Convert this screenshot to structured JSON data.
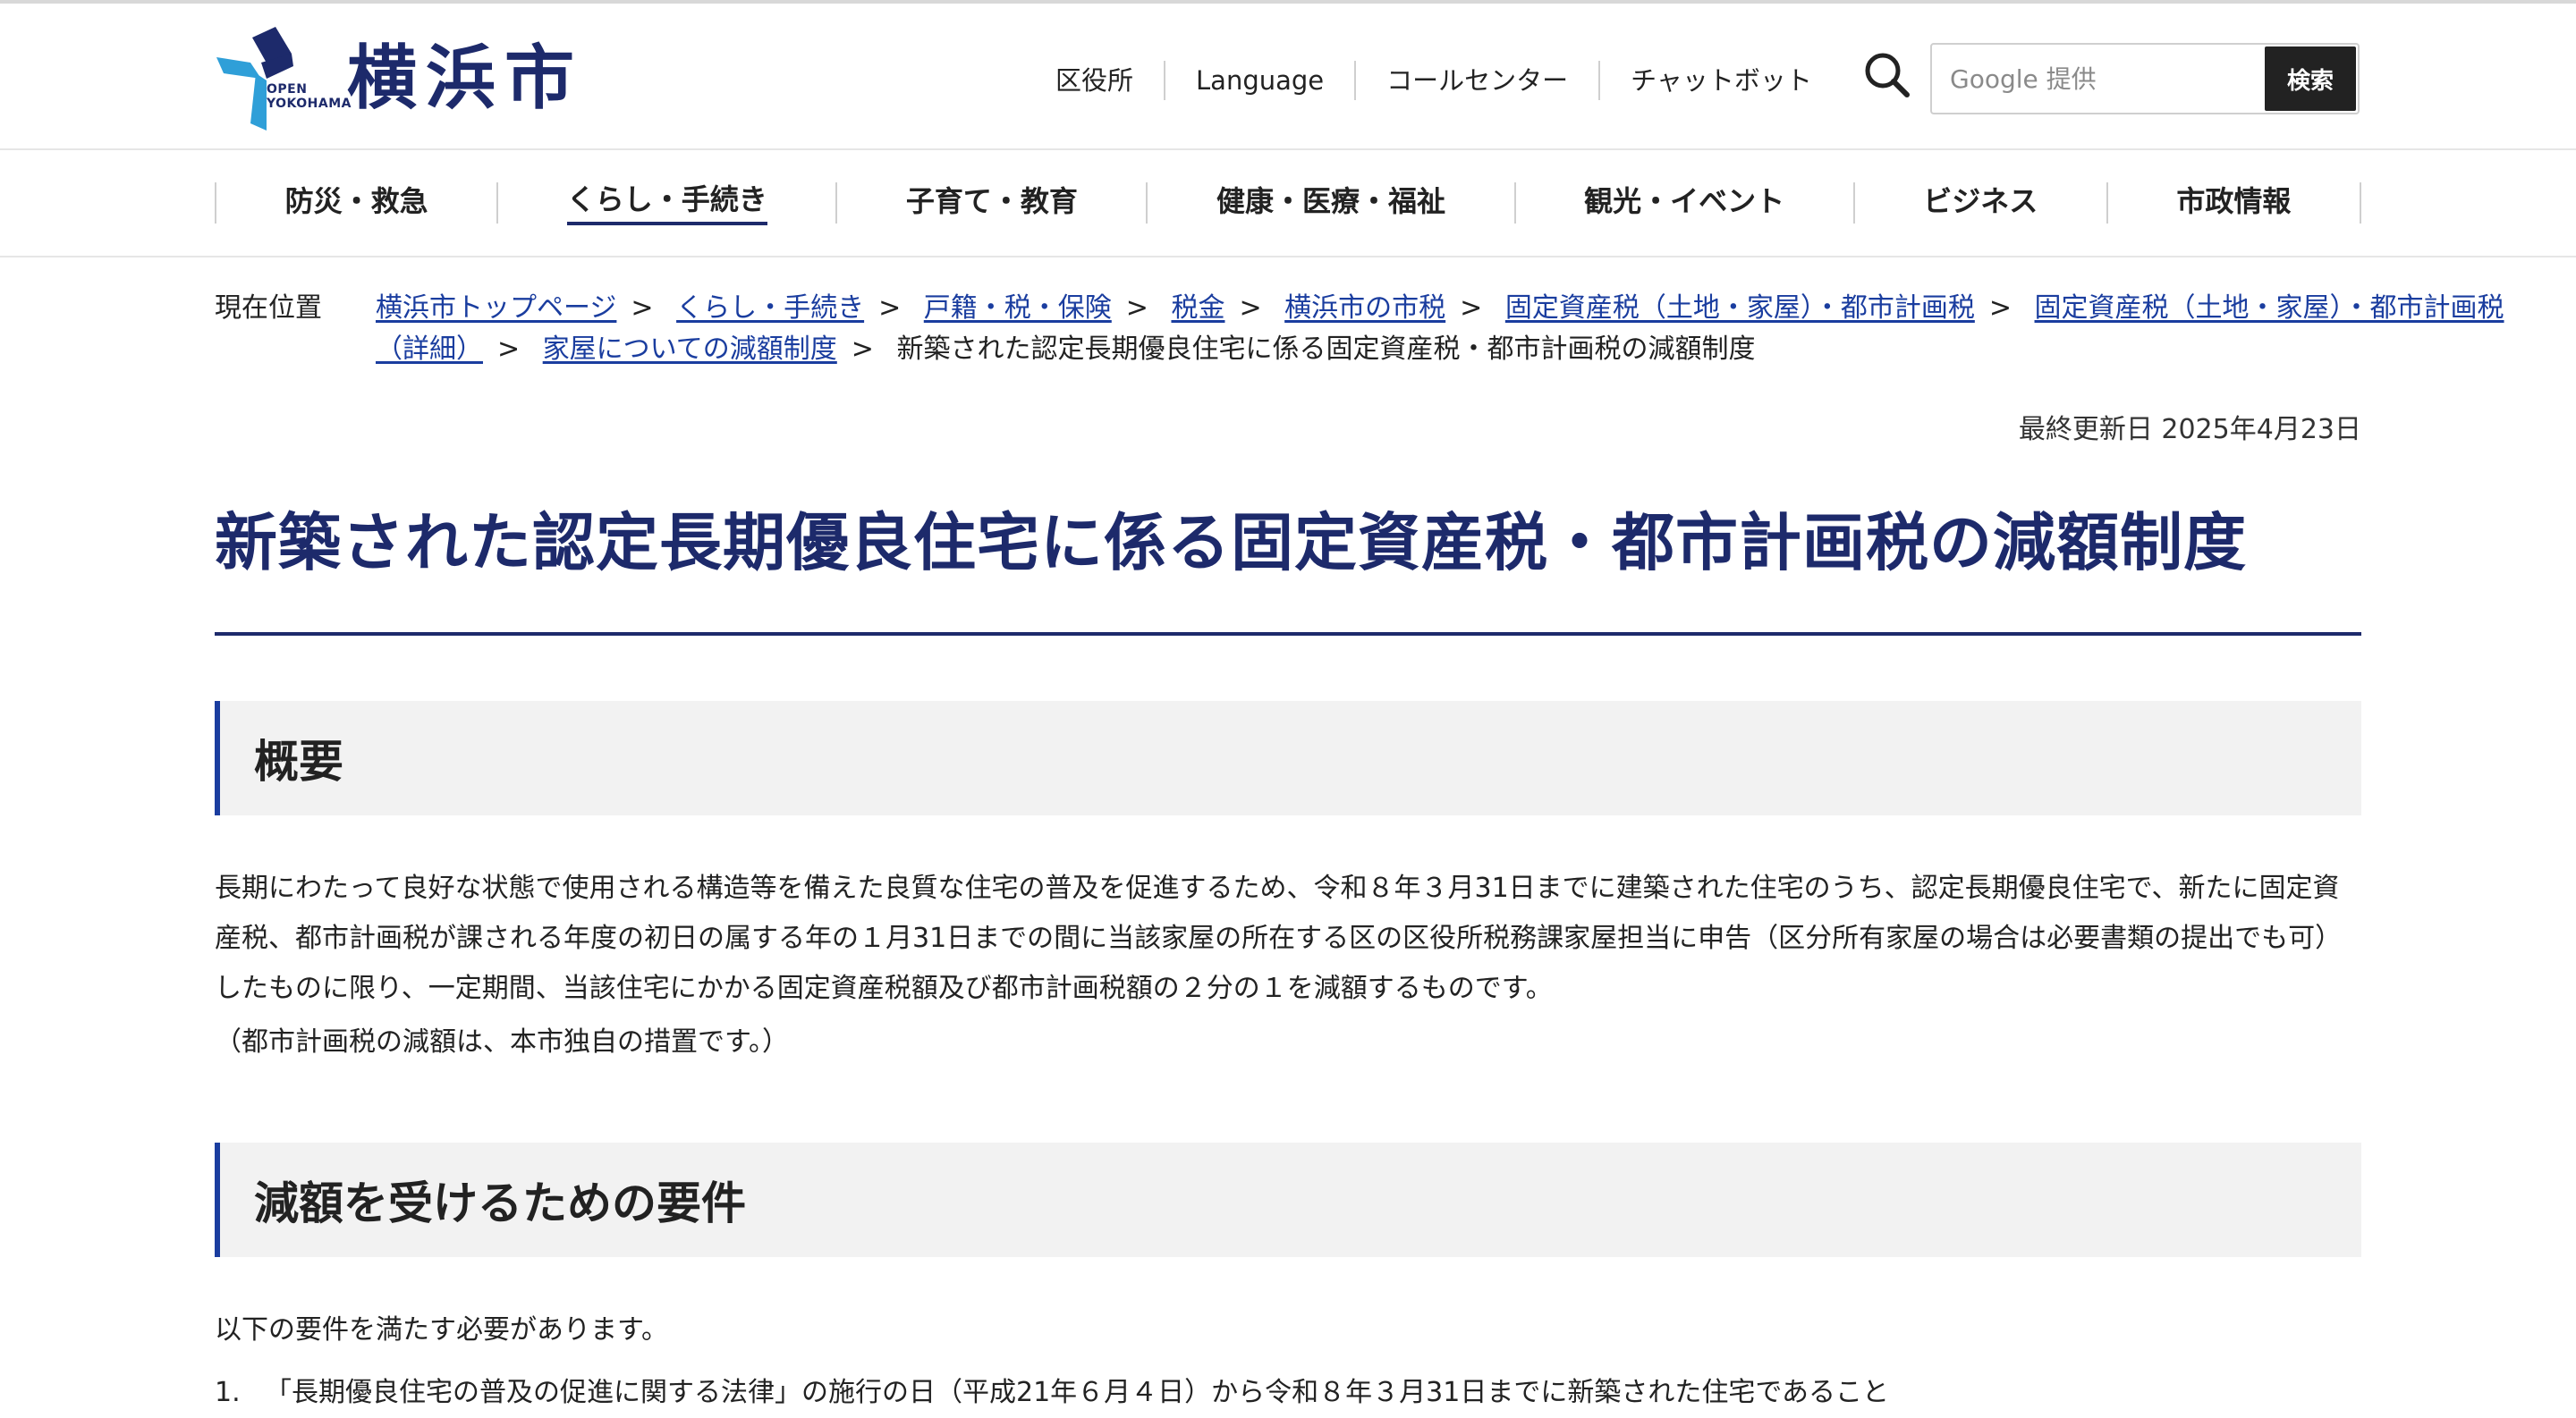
{
  "header": {
    "logo_text": "横浜市",
    "logo_sub_line1": "OPEN",
    "logo_sub_line2": "YOKOHAMA",
    "util_nav": [
      "区役所",
      "Language",
      "コールセンター",
      "チャットボット"
    ],
    "search": {
      "placeholder": "Google 提供",
      "button_label": "検索"
    }
  },
  "global_nav": [
    {
      "label": "防災・救急"
    },
    {
      "label": "くらし・手続き"
    },
    {
      "label": "子育て・教育"
    },
    {
      "label": "健康・医療・福祉"
    },
    {
      "label": "観光・イベント"
    },
    {
      "label": "ビジネス"
    },
    {
      "label": "市政情報"
    }
  ],
  "breadcrumb": {
    "label": "現在位置",
    "links": [
      "横浜市トップページ",
      "くらし・手続き",
      "戸籍・税・保険",
      "税金",
      "横浜市の市税",
      "固定資産税（土地・家屋）・都市計画税",
      "固定資産税（土地・家屋）・都市計画税（詳細）",
      "家屋についての減額制度"
    ],
    "current": "新築された認定長期優良住宅に係る固定資産税・都市計画税の減額制度"
  },
  "updated": "最終更新日 2025年4月23日",
  "page_title": "新築された認定長期優良住宅に係る固定資産税・都市計画税の減額制度",
  "sections": [
    {
      "heading": "概要",
      "paragraphs": [
        "長期にわたって良好な状態で使用される構造等を備えた良質な住宅の普及を促進するため、令和８年３月31日までに建築された住宅のうち、認定長期優良住宅で、新たに固定資産税、都市計画税が課される年度の初日の属する年の１月31日までの間に当該家屋の所在する区の区役所税務課家屋担当に申告（区分所有家屋の場合は必要書類の提出でも可）したものに限り、一定期間、当該住宅にかかる固定資産税額及び都市計画税額の２分の１を減額するものです。",
        "（都市計画税の減額は、本市独自の措置です。）"
      ]
    },
    {
      "heading": "減額を受けるための要件",
      "paragraphs": [
        "以下の要件を満たす必要があります。"
      ],
      "list": [
        {
          "num": "1.",
          "text": "「長期優良住宅の普及の促進に関する法律」の施行の日（平成21年６月４日）から令和８年３月31日までに新築された住宅であること"
        }
      ]
    }
  ],
  "colors": {
    "brand_navy": "#1d2a6b",
    "link_blue": "#1a3d9f",
    "section_bg": "#f2f2f2",
    "search_button_bg": "#222222"
  },
  "icons": {
    "logo": "yokohama-logo-icon",
    "search": "search-icon"
  }
}
